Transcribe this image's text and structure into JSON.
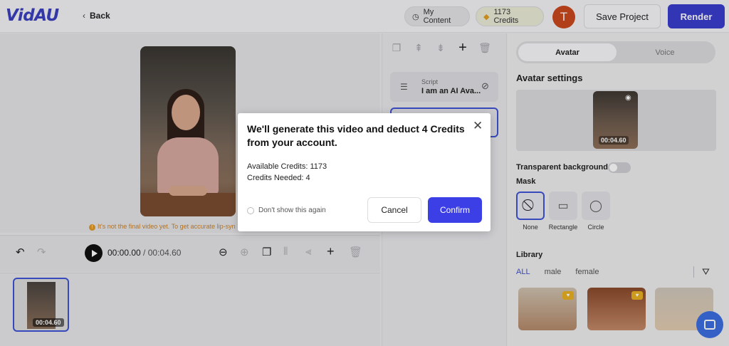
{
  "app": {
    "logo": "VidAU"
  },
  "header": {
    "back_label": "Back",
    "my_content": "My Content",
    "credits": "1173 Credits",
    "user_initial": "T",
    "save_label": "Save Project",
    "render_label": "Render"
  },
  "canvas": {
    "warning": "It's not the final video yet. To get accurate lip-syn"
  },
  "player": {
    "current_time": "00:00.00",
    "separator": " / ",
    "duration": "00:04.60"
  },
  "timeline": {
    "clip_duration": "00:04.60"
  },
  "scenes": {
    "script_label": "Script",
    "script_text": "I am an AI Ava..."
  },
  "right_panel": {
    "tabs": [
      "Avatar",
      "Voice"
    ],
    "settings_title": "Avatar settings",
    "avatar_duration": "00:04.60",
    "transparent_bg_label": "Transparent background",
    "mask_title": "Mask",
    "mask_options": [
      "None",
      "Rectangle",
      "Circle"
    ],
    "library_title": "Library",
    "library_tabs": [
      "ALL",
      "male",
      "female"
    ]
  },
  "dialog": {
    "title": "We'll generate this video and deduct 4 Credits from your account.",
    "available_credits": "Available Credits: 1173",
    "credits_needed": "Credits Needed: 4",
    "dont_show": "Don't show this again",
    "cancel_label": "Cancel",
    "confirm_label": "Confirm"
  },
  "colors": {
    "accent": "#3a3dcd",
    "confirm": "#3d3fe6",
    "warning": "#c9822a",
    "user_avatar": "#c9481e"
  }
}
